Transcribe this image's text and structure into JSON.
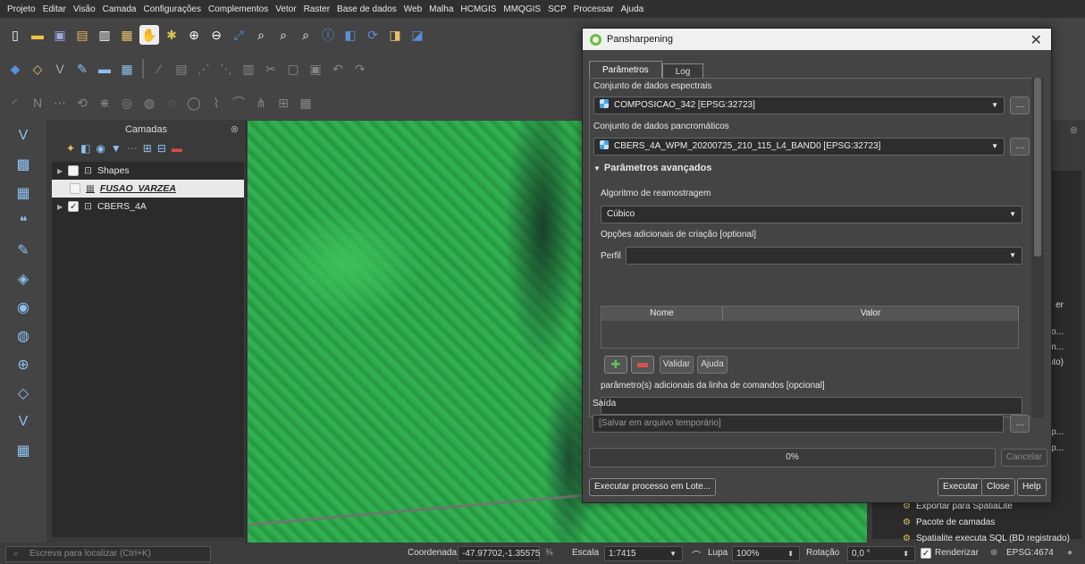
{
  "menubar": [
    "Projeto",
    "Editar",
    "Visão",
    "Camada",
    "Configurações",
    "Complementos",
    "Vetor",
    "Raster",
    "Base de dados",
    "Web",
    "Malha",
    "HCMGIS",
    "MMQGIS",
    "SCP",
    "Processar",
    "Ajuda"
  ],
  "layers_panel": {
    "title": "Camadas",
    "items": [
      {
        "label": "Shapes",
        "checked": false
      },
      {
        "label": "FUSAO_VARZEA",
        "checked": false
      },
      {
        "label": "CBERS_4A",
        "checked": true
      }
    ]
  },
  "dialog": {
    "title": "Pansharpening",
    "tabs": [
      "Parâmetros",
      "Log"
    ],
    "spectral_label": "Conjunto de dados espectrais",
    "spectral_value": "COMPOSICAO_342 [EPSG:32723]",
    "pan_label": "Conjunto de dados pancromáticos",
    "pan_value": "CBERS_4A_WPM_20200725_210_115_L4_BAND0 [EPSG:32723]",
    "advanced_label": "Parâmetros avançados",
    "resample_label": "Algoritmo de reamostragem",
    "resample_value": "Cúbico",
    "creation_label": "Opções adicionais de criação [optional]",
    "profile_label": "Perfil",
    "table_cols": [
      "Nome",
      "Valor"
    ],
    "validate_btn": "Validar",
    "help_btn_small": "Ajuda",
    "extra_label": "parâmetro(s) adicionais da linha de comandos [opcional]",
    "output_label": "Saída",
    "output_placeholder": "[Salvar em arquivo temporário]",
    "progress": "0%",
    "cancel": "Cancelar",
    "batch": "Executar processo em Lote...",
    "run": "Executar",
    "close": "Close",
    "help": "Help"
  },
  "right_panel": {
    "fragments": [
      "er",
      "po...",
      "m...",
      "nto)",
      "p...",
      "p..."
    ],
    "items": [
      "Exportar para SpatiaLite",
      "Pacote de camadas",
      "Spatialite executa SQL (BD registrado)"
    ]
  },
  "statusbar": {
    "search_placeholder": "Escreva para localizar (Ctrl+K)",
    "coord_label": "Coordenada",
    "coord_value": "-47.97702,-1.35575",
    "scale_label": "Escala",
    "scale_value": "1:7415",
    "zoom_label": "Lupa",
    "zoom_value": "100%",
    "rotation_label": "Rotação",
    "rotation_value": "0,0 °",
    "render_label": "Renderizar",
    "crs": "EPSG:4674"
  }
}
